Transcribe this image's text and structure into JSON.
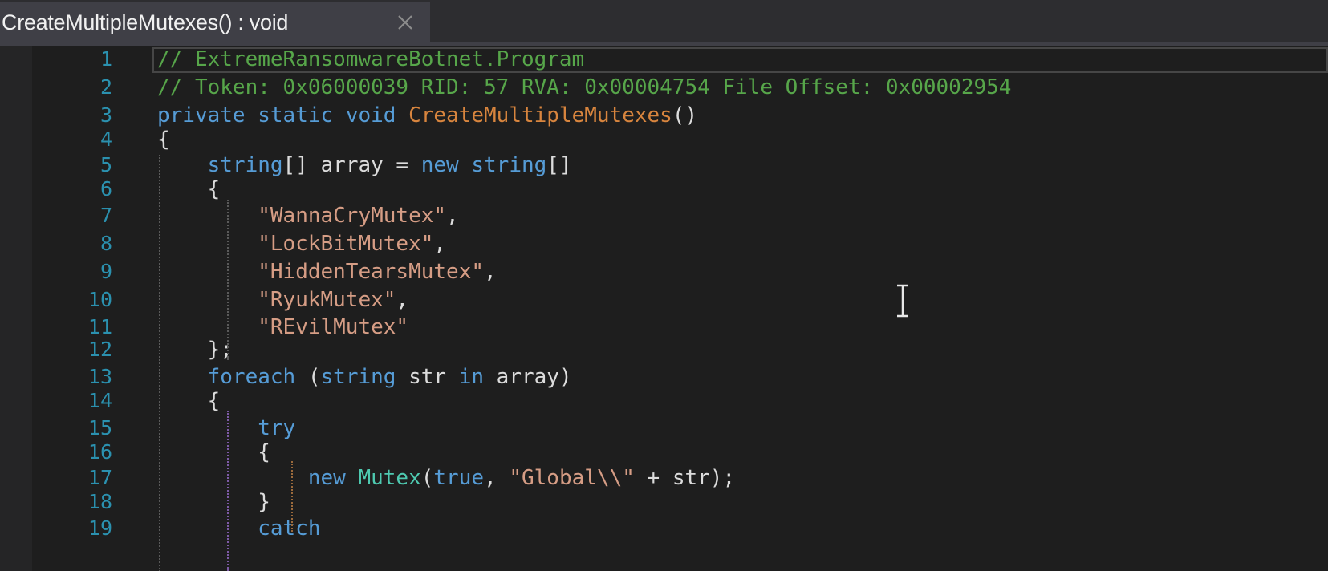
{
  "tab": {
    "title": "CreateMultipleMutexes() : void",
    "close_icon": "close-icon"
  },
  "code_lines": [
    {
      "n": "1",
      "tokens": [
        {
          "t": "// ExtremeRansomwareBotnet.Program",
          "c": "cm"
        }
      ]
    },
    {
      "n": "2",
      "tokens": [
        {
          "t": "// Token: 0x06000039 RID: 57 RVA: 0x00004754 File Offset: 0x00002954",
          "c": "cm"
        }
      ]
    },
    {
      "n": "3",
      "tokens": [
        {
          "t": "private",
          "c": "kw"
        },
        {
          "t": " ",
          "c": "pl"
        },
        {
          "t": "static",
          "c": "kw"
        },
        {
          "t": " ",
          "c": "pl"
        },
        {
          "t": "void",
          "c": "kw"
        },
        {
          "t": " ",
          "c": "pl"
        },
        {
          "t": "CreateMultipleMutexes",
          "c": "fn"
        },
        {
          "t": "()",
          "c": "pl"
        }
      ]
    },
    {
      "n": "4",
      "tokens": [
        {
          "t": "{",
          "c": "pl"
        }
      ]
    },
    {
      "n": "5",
      "tokens": [
        {
          "t": "    ",
          "c": "pl"
        },
        {
          "t": "string",
          "c": "kw"
        },
        {
          "t": "[] array = ",
          "c": "pl"
        },
        {
          "t": "new",
          "c": "kw"
        },
        {
          "t": " ",
          "c": "pl"
        },
        {
          "t": "string",
          "c": "kw"
        },
        {
          "t": "[]",
          "c": "pl"
        }
      ]
    },
    {
      "n": "6",
      "tokens": [
        {
          "t": "    {",
          "c": "pl"
        }
      ]
    },
    {
      "n": "7",
      "tokens": [
        {
          "t": "        ",
          "c": "pl"
        },
        {
          "t": "\"WannaCryMutex\"",
          "c": "str"
        },
        {
          "t": ",",
          "c": "pl"
        }
      ]
    },
    {
      "n": "8",
      "tokens": [
        {
          "t": "        ",
          "c": "pl"
        },
        {
          "t": "\"LockBitMutex\"",
          "c": "str"
        },
        {
          "t": ",",
          "c": "pl"
        }
      ]
    },
    {
      "n": "9",
      "tokens": [
        {
          "t": "        ",
          "c": "pl"
        },
        {
          "t": "\"HiddenTearsMutex\"",
          "c": "str"
        },
        {
          "t": ",",
          "c": "pl"
        }
      ]
    },
    {
      "n": "10",
      "tokens": [
        {
          "t": "        ",
          "c": "pl"
        },
        {
          "t": "\"RyukMutex\"",
          "c": "str"
        },
        {
          "t": ",",
          "c": "pl"
        }
      ]
    },
    {
      "n": "11",
      "tokens": [
        {
          "t": "        ",
          "c": "pl"
        },
        {
          "t": "\"REvilMutex\"",
          "c": "str"
        }
      ]
    },
    {
      "n": "12",
      "tokens": [
        {
          "t": "    };",
          "c": "pl"
        }
      ]
    },
    {
      "n": "13",
      "tokens": [
        {
          "t": "    ",
          "c": "pl"
        },
        {
          "t": "foreach",
          "c": "kw"
        },
        {
          "t": " (",
          "c": "pl"
        },
        {
          "t": "string",
          "c": "kw"
        },
        {
          "t": " str ",
          "c": "pl"
        },
        {
          "t": "in",
          "c": "kw"
        },
        {
          "t": " array)",
          "c": "pl"
        }
      ]
    },
    {
      "n": "14",
      "tokens": [
        {
          "t": "    {",
          "c": "pl"
        }
      ]
    },
    {
      "n": "15",
      "tokens": [
        {
          "t": "        ",
          "c": "pl"
        },
        {
          "t": "try",
          "c": "kw"
        }
      ]
    },
    {
      "n": "16",
      "tokens": [
        {
          "t": "        {",
          "c": "pl"
        }
      ]
    },
    {
      "n": "17",
      "tokens": [
        {
          "t": "            ",
          "c": "pl"
        },
        {
          "t": "new",
          "c": "kw"
        },
        {
          "t": " ",
          "c": "pl"
        },
        {
          "t": "Mutex",
          "c": "ty"
        },
        {
          "t": "(",
          "c": "pl"
        },
        {
          "t": "true",
          "c": "kw"
        },
        {
          "t": ", ",
          "c": "pl"
        },
        {
          "t": "\"Global\\\\\"",
          "c": "str"
        },
        {
          "t": " + str);",
          "c": "pl"
        }
      ]
    },
    {
      "n": "18",
      "tokens": [
        {
          "t": "        }",
          "c": "pl"
        }
      ]
    },
    {
      "n": "19",
      "tokens": [
        {
          "t": "        ",
          "c": "pl"
        },
        {
          "t": "catch",
          "c": "kw"
        }
      ]
    }
  ],
  "colors": {
    "background": "#1e1e1e",
    "keyword": "#569cd6",
    "comment": "#57a64a",
    "string": "#d69d85",
    "method": "#d8853e",
    "type": "#4ec9b0",
    "line_number": "#2b91af"
  },
  "icons": {
    "text_cursor": "text-cursor-icon"
  }
}
